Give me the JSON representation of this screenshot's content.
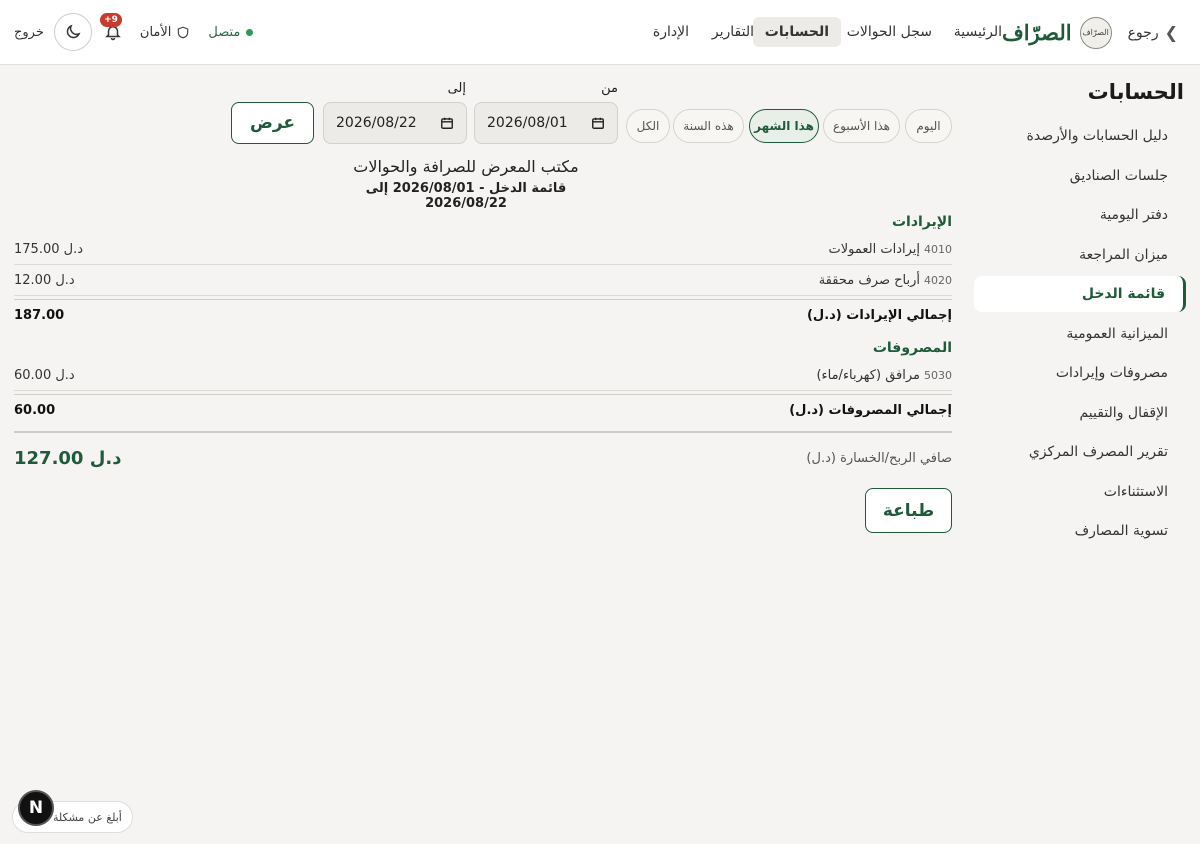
{
  "topbar": {
    "back_label": "رجوع",
    "logo_text": "الصرّاف",
    "brand_name": "الصرّاف",
    "nav": [
      "الرئيسية",
      "سجل الحوالات",
      "الحسابات",
      "التقارير",
      "الإدارة"
    ],
    "active_nav": "الحسابات",
    "status_label": "متصل",
    "security_label": "الأمان",
    "notification_count": "+9",
    "logout_label": "خروج",
    "icons": {
      "theme": "moon-icon",
      "notifications": "bell-icon",
      "security": "shield-icon",
      "back": "chevron-right-icon"
    }
  },
  "sidebar": {
    "title": "الحسابات",
    "items": [
      "دليل الحسابات والأرصدة",
      "جلسات الصناديق",
      "دفتر اليومية",
      "ميزان المراجعة",
      "قائمة الدخل",
      "الميزانية العمومية",
      "مصروفات وإيرادات",
      "الإقفال والتقييم",
      "تقرير المصرف المركزي",
      "الاستثناءات",
      "تسوية المصارف"
    ],
    "active_item": "قائمة الدخل"
  },
  "filters": {
    "periods": [
      "اليوم",
      "هذا الأسبوع",
      "هذا الشهر",
      "هذه السنة",
      "الكل"
    ],
    "active_period": "هذا الشهر",
    "from_label": "من",
    "to_label": "إلى",
    "from_date": "2026/08/01",
    "to_date": "2026/08/22",
    "show_button": "عرض"
  },
  "report": {
    "title": "مكتب المعرض للصرافة والحوالات",
    "subtitle": "قائمة الدخل - 2026/08/01 إلى 2026/08/22",
    "revenue": {
      "heading": "الإيرادات",
      "rows": [
        {
          "code": "4010",
          "name": "إيرادات العمولات",
          "amount": "175.00 د.ل"
        },
        {
          "code": "4020",
          "name": "أرباح صرف محققة",
          "amount": "12.00 د.ل"
        }
      ],
      "total_label": "إجمالي الإيرادات (د.ل)",
      "total_value": "187.00"
    },
    "expenses": {
      "heading": "المصروفات",
      "rows": [
        {
          "code": "5030",
          "name": "مرافق (كهرباء/ماء)",
          "amount": "60.00 د.ل"
        }
      ],
      "total_label": "إجمالي المصروفات (د.ل)",
      "total_value": "60.00"
    },
    "net_label": "صافي الربح/الخسارة (د.ل)",
    "net_value": "127.00 د.ل",
    "print_button": "طباعة"
  },
  "widget": {
    "help_label": "أبلغ عن مشكلة",
    "avatar_letter": "N"
  },
  "colors": {
    "accent": "#1f5a3a",
    "badge": "#c53d2f",
    "status": "#2a9a55"
  }
}
